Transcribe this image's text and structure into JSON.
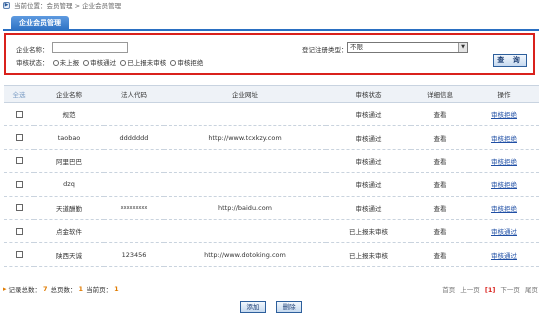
{
  "breadcrumb": {
    "text": "当前位置：会员管理 > 企业会员管理"
  },
  "tab": {
    "label": "企业会员管理"
  },
  "search": {
    "name_label": "企业名称：",
    "name_value": "",
    "reg_type_label": "登记注册类型：",
    "reg_type_selected": "不限",
    "status_label": "审核状态：",
    "status_options": [
      "未上报",
      "审核通过",
      "已上报未审核",
      "审核拒绝"
    ],
    "query_label": "查 询"
  },
  "table": {
    "headers": [
      "全选",
      "企业名称",
      "法人代码",
      "企业网址",
      "审核状态",
      "详细信息",
      "操作"
    ],
    "rows": [
      {
        "name": "规范",
        "code": "",
        "url": "",
        "status": "审核通过",
        "detail": "查看",
        "action": "审核拒绝"
      },
      {
        "name": "taobao",
        "code": "ddddddd",
        "url": "http://www.tcxkzy.com",
        "status": "审核通过",
        "detail": "查看",
        "action": "审核拒绝"
      },
      {
        "name": "阿里巴巴",
        "code": "",
        "url": "",
        "status": "审核通过",
        "detail": "查看",
        "action": "审核拒绝"
      },
      {
        "name": "dzq",
        "code": "",
        "url": "",
        "status": "审核通过",
        "detail": "查看",
        "action": "审核拒绝"
      },
      {
        "name": "天道酬勤",
        "code": "xxxxxxxxx",
        "url": "http://baidu.com",
        "status": "审核通过",
        "detail": "查看",
        "action": "审核拒绝"
      },
      {
        "name": "点金软件",
        "code": "",
        "url": "",
        "status": "已上报未审核",
        "detail": "查看",
        "action": "审核通过"
      },
      {
        "name": "陕西天诚",
        "code": "123456",
        "url": "http://www.dotoking.com",
        "status": "已上报未审核",
        "detail": "查看",
        "action": "审核通过"
      }
    ]
  },
  "footer": {
    "total_label": "记录总数：",
    "total": "7",
    "pages_label": "总页数：",
    "pages": "1",
    "current_label": "当前页：",
    "current": "1"
  },
  "pager": {
    "first": "首页",
    "prev": "上一页",
    "current": "[1]",
    "next": "下一页",
    "last": "尾页"
  },
  "buttons": {
    "add": "添加",
    "delete": "删除"
  },
  "colors": {
    "accent": "#2a6fc2",
    "search_border": "#d9211c",
    "link": "#1f4fa5"
  }
}
